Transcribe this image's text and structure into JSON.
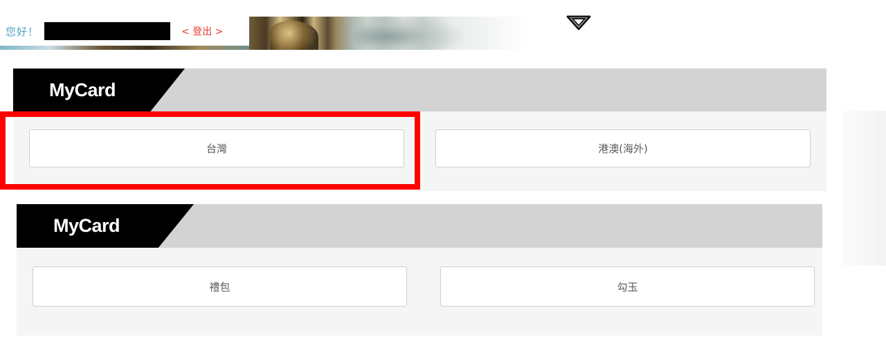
{
  "header": {
    "greeting": "您好！",
    "username": "",
    "logout_label": "< 登出 >"
  },
  "sections": [
    {
      "title": "MyCard",
      "options": [
        {
          "label": "台灣"
        },
        {
          "label": "港澳(海外)"
        }
      ]
    },
    {
      "title": "MyCard",
      "options": [
        {
          "label": "禮包"
        },
        {
          "label": "勾玉"
        }
      ]
    }
  ],
  "colors": {
    "greeting": "#4fa3c7",
    "logout": "#e53b2b",
    "tab_bg": "#000000",
    "header_bar": "#d3d3d3",
    "body_bg": "#f5f5f5",
    "highlight": "#ff0000"
  },
  "highlight": {
    "target": "section-1-option-taiwan"
  }
}
